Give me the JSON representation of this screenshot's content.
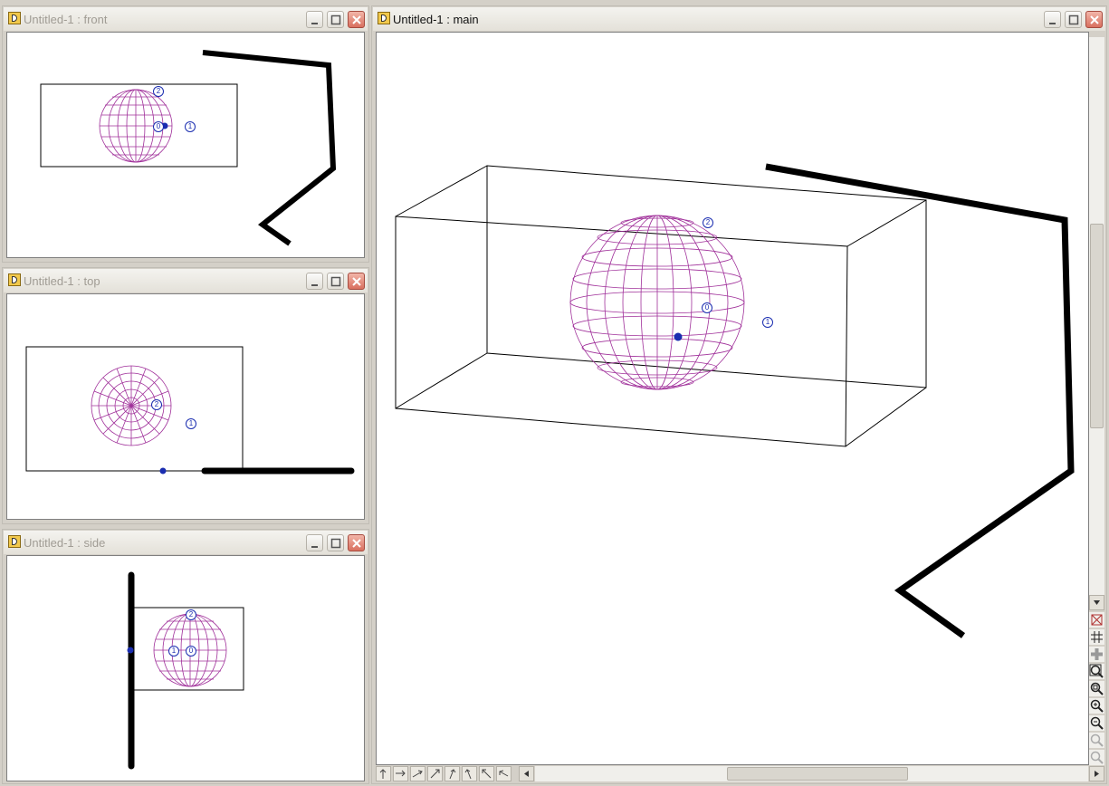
{
  "windows": {
    "front": {
      "title": "Untitled-1 : front"
    },
    "top": {
      "title": "Untitled-1 : top"
    },
    "side": {
      "title": "Untitled-1 : side"
    },
    "main": {
      "title": "Untitled-1 : main"
    }
  },
  "point_labels": {
    "one": "1",
    "two": "2",
    "zero": "0"
  },
  "colors": {
    "wireframe": "#a0309a",
    "handle": "#1a2db0",
    "path": "#000000",
    "box": "#000000"
  },
  "icons": {
    "title_buttons": [
      "minimize-icon",
      "maximize-icon",
      "close-icon"
    ],
    "view_tools": [
      "wireframe-toggle-icon",
      "grid-icon",
      "crosshair-icon",
      "zoom-fit-icon",
      "zoom-region-icon",
      "zoom-in-icon",
      "zoom-out-icon",
      "zoom-reset-icon",
      "zoom-all-icon"
    ],
    "move_tools": [
      "move-up-icon",
      "move-right-icon",
      "move-diag-right-icon",
      "move-diag-up-icon",
      "rotate-up-icon",
      "rotate-side-icon",
      "move-diag-left-icon",
      "move-left-icon"
    ]
  }
}
